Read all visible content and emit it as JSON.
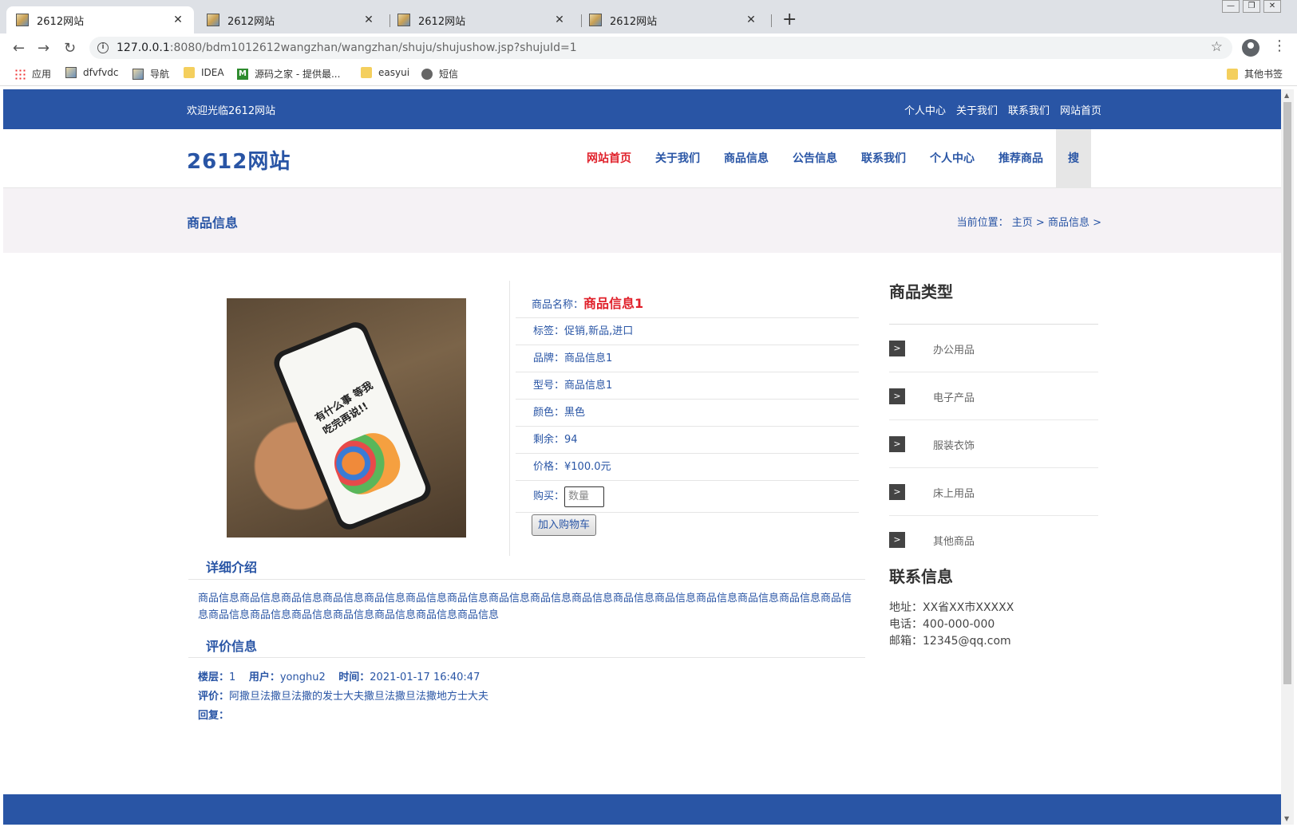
{
  "browser": {
    "tabs": [
      {
        "title": "2612网站",
        "active": true
      },
      {
        "title": "2612网站",
        "active": false
      },
      {
        "title": "2612网站",
        "active": false
      },
      {
        "title": "2612网站",
        "active": false
      }
    ],
    "new_tab_label": "+",
    "url_host": "127.0.0.1",
    "url_rest": ":8080/bdm1012612wangzhan/wangzhan/shuju/shujushow.jsp?shujuId=1",
    "bookmarks": [
      {
        "label": "应用",
        "icon": "apps-icon"
      },
      {
        "label": "dfvfvdc",
        "icon": "image-icon"
      },
      {
        "label": "导航",
        "icon": "image-icon"
      },
      {
        "label": "IDEA",
        "icon": "folder-icon"
      },
      {
        "label": "源码之家 - 提供最...",
        "icon": "m-icon"
      },
      {
        "label": "easyui",
        "icon": "folder-icon"
      },
      {
        "label": "短信",
        "icon": "globe-icon"
      }
    ],
    "other_bookmarks": "其他书签"
  },
  "site": {
    "welcome": "欢迎光临2612网站",
    "top_links": [
      "个人中心",
      "关于我们",
      "联系我们",
      "网站首页"
    ],
    "logo": "2612网站",
    "nav": [
      "网站首页",
      "关于我们",
      "商品信息",
      "公告信息",
      "联系我们",
      "个人中心",
      "推荐商品"
    ],
    "search_label": "搜",
    "page_title": "商品信息",
    "breadcrumb": "当前位置： 主页 > 商品信息 >",
    "colors": {
      "primary": "#2955a5",
      "accent": "#e0202a",
      "crumb_bg": "#f5f2f5"
    }
  },
  "product": {
    "name_label": "商品名称：",
    "name": "商品信息1",
    "tags": "标签：促销,新品,进口",
    "brand": "品牌：商品信息1",
    "model": "型号：商品信息1",
    "color": "颜色：黑色",
    "stock": "剩余：94",
    "price": "价格：¥100.0元",
    "buy_label": "购买：",
    "qty_placeholder": "数量",
    "cart_button": "加入购物车",
    "phone_caption": "有什么事 等我吃完再说!!"
  },
  "detail": {
    "title": "详细介绍",
    "text": "商品信息商品信息商品信息商品信息商品信息商品信息商品信息商品信息商品信息商品信息商品信息商品信息商品信息商品信息商品信息商品信息商品信息商品信息商品信息商品信息商品信息商品信息商品信息"
  },
  "reviews": {
    "title": "评价信息",
    "floor_label": "楼层：",
    "floor": "1",
    "user_label": "用户：",
    "user": "yonghu2",
    "time_label": "时间：",
    "time": "2021-01-17 16:40:47",
    "comment_label": "评价：",
    "comment": "阿撒旦法撒旦法撒的发士大夫撒旦法撒旦法撒地方士大夫",
    "reply_label": "回复："
  },
  "sidebar": {
    "category_title": "商品类型",
    "categories": [
      "办公用品",
      "电子产品",
      "服装衣饰",
      "床上用品",
      "其他商品"
    ],
    "contact_title": "联系信息",
    "address": "地址：XX省XX市XXXXX",
    "phone": "电话：400-000-000",
    "email": "邮箱：12345@qq.com"
  }
}
